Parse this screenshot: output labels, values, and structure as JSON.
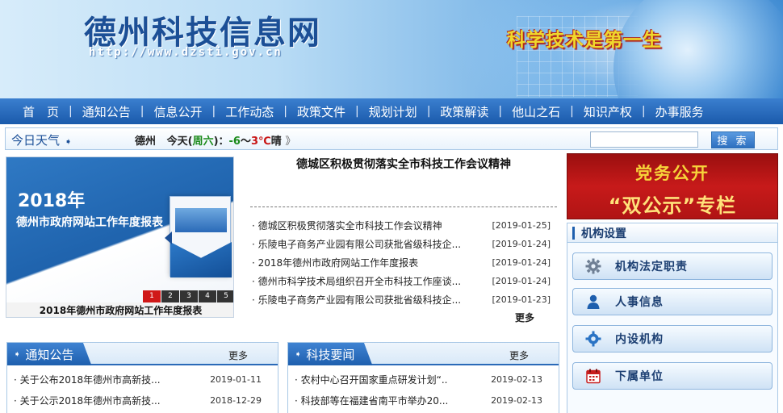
{
  "header": {
    "site_title": "德州科技信息网",
    "site_url": "http://www.dzsti.gov.cn",
    "slogan": "科学技术是第一生"
  },
  "nav": {
    "items": [
      "首　页",
      "通知公告",
      "信息公开",
      "工作动态",
      "政策文件",
      "规划计划",
      "政策解读",
      "他山之石",
      "知识产权",
      "办事服务"
    ]
  },
  "weather": {
    "tab_label": "今日天气",
    "city": "德州",
    "today": "今天",
    "weekday": "周六",
    "low": "-6",
    "tilde": "～",
    "high": "3℃",
    "condition": "晴",
    "more": "》"
  },
  "search": {
    "value": "",
    "button_label": "搜 索"
  },
  "slideshow": {
    "year_title": "2018年",
    "report_title": "德州市政府网站工作年度报表",
    "pages": [
      "1",
      "2",
      "3",
      "4",
      "5"
    ],
    "active_page": 1,
    "caption": "2018年德州市政府网站工作年度报表"
  },
  "headline": {
    "title": "德城区积极贯彻落实全市科技工作会议精神"
  },
  "news": {
    "items": [
      {
        "title": "· 德城区积极贯彻落实全市科技工作会议精神",
        "date": "[2019-01-25]"
      },
      {
        "title": "· 乐陵电子商务产业园有限公司获批省级科技企...",
        "date": "[2019-01-24]"
      },
      {
        "title": "· 2018年德州市政府网站工作年度报表",
        "date": "[2019-01-24]"
      },
      {
        "title": "· 德州市科学技术局组织召开全市科技工作座谈...",
        "date": "[2019-01-24]"
      },
      {
        "title": "· 乐陵电子商务产业园有限公司获批省级科技企...",
        "date": "[2019-01-23]"
      }
    ],
    "more_label": "更多"
  },
  "notice_box": {
    "title": "通知公告",
    "more_label": "更多",
    "items": [
      {
        "title": "· 关于公布2018年德州市高新技...",
        "date": "2019-01-11"
      },
      {
        "title": "· 关于公示2018年德州市高新技...",
        "date": "2018-12-29"
      }
    ]
  },
  "tech_box": {
    "title": "科技要闻",
    "more_label": "更多",
    "items": [
      {
        "title": "· 农村中心召开国家重点研发计划“...",
        "date": "2019-02-13"
      },
      {
        "title": "· 科技部等在福建省南平市举办20...",
        "date": "2019-02-13"
      }
    ]
  },
  "party_banner": {
    "line1": "党务公开",
    "line2": "“双公示”专栏"
  },
  "org": {
    "header": "机构设置",
    "buttons": [
      {
        "label": "机构法定职责",
        "icon": "gear-icon",
        "color": "#6f7f94"
      },
      {
        "label": "人事信息",
        "icon": "person-icon",
        "color": "#1e5fae"
      },
      {
        "label": "内设机构",
        "icon": "cog-icon",
        "color": "#2a73c4"
      },
      {
        "label": "下属单位",
        "icon": "calendar-icon",
        "color": "#c81e1e"
      }
    ]
  },
  "colors": {
    "brand_blue": "#1c4f96",
    "nav_blue": "#1a5aab",
    "party_red": "#c71a1a",
    "slogan_yellow": "#f0d82c"
  }
}
